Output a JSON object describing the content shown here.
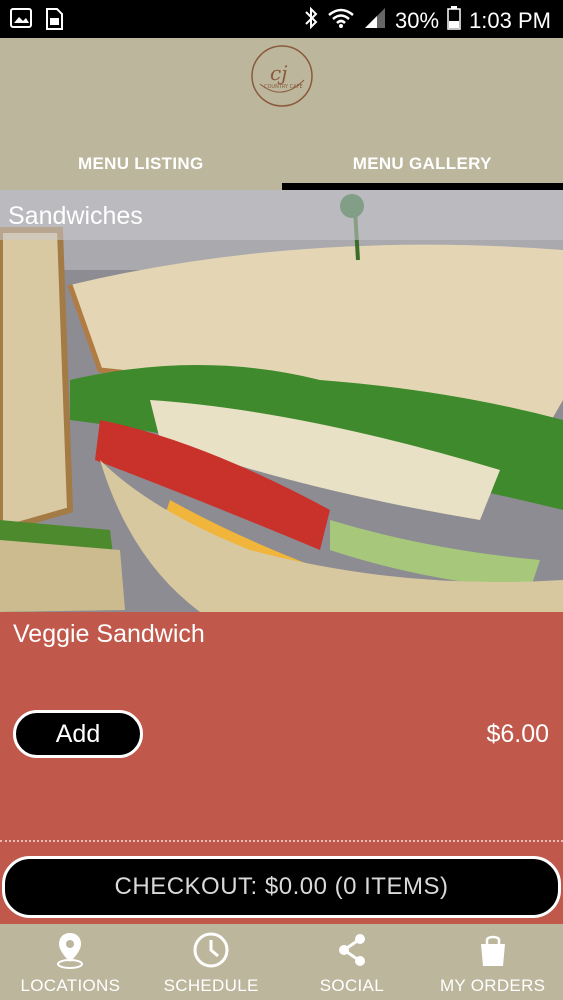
{
  "status_bar": {
    "battery": "30%",
    "time": "1:03 PM"
  },
  "header": {
    "logo_text": "CJ's",
    "tabs": [
      {
        "label": "MENU LISTING",
        "active": false
      },
      {
        "label": "MENU GALLERY",
        "active": true
      }
    ]
  },
  "gallery": {
    "category": "Sandwiches",
    "item": {
      "name": "Veggie Sandwich",
      "add_label": "Add",
      "price": "$6.00"
    }
  },
  "checkout": {
    "label": "CHECKOUT: $0.00 (0 ITEMS)"
  },
  "bottom_nav": {
    "items": [
      {
        "label": "LOCATIONS",
        "icon": "map-pin-icon"
      },
      {
        "label": "SCHEDULE",
        "icon": "clock-icon"
      },
      {
        "label": "SOCIAL",
        "icon": "share-icon"
      },
      {
        "label": "MY ORDERS",
        "icon": "shopping-bag-icon"
      }
    ]
  },
  "colors": {
    "header_bg": "#bcb69d",
    "panel_bg": "#c0584b",
    "button_bg": "#000000"
  }
}
